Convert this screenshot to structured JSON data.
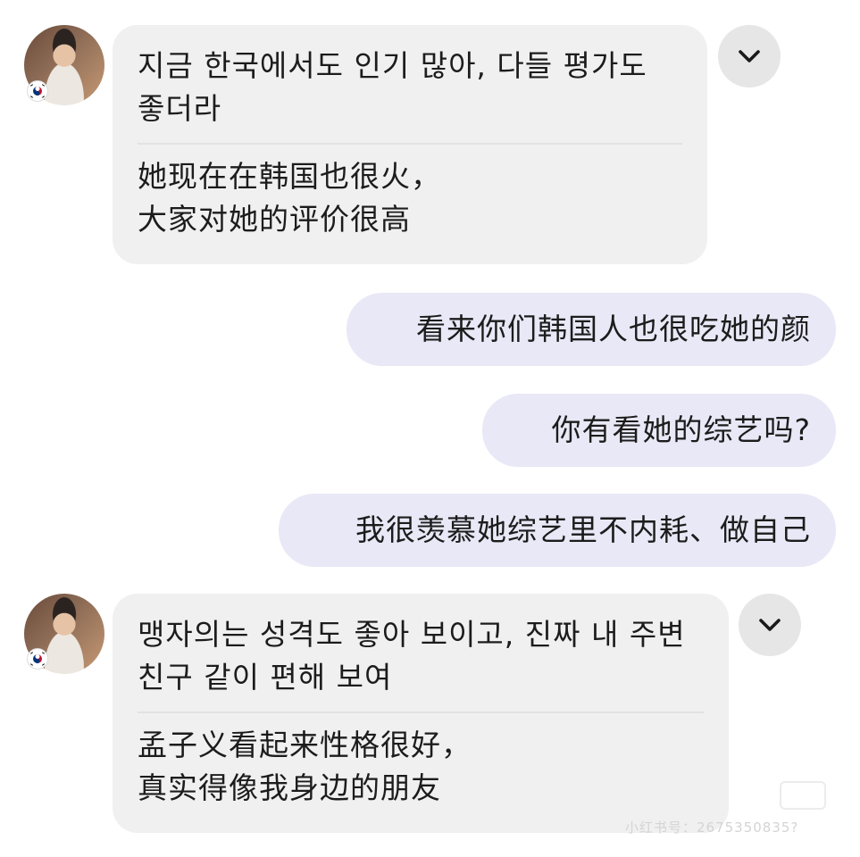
{
  "messages": [
    {
      "direction": "incoming",
      "original": "지금 한국에서도 인기 많아, 다들 평가도 좋더라",
      "translation": "她现在在韩国也很火，大家对她的评价很高"
    },
    {
      "direction": "outgoing",
      "text": "看来你们韩国人也很吃她的颜"
    },
    {
      "direction": "outgoing",
      "text": "你有看她的综艺吗?"
    },
    {
      "direction": "outgoing",
      "text": "我很羡慕她综艺里不内耗、做自己"
    },
    {
      "direction": "incoming",
      "original": "맹자의는 성격도 좋아 보이고, 진짜 내 주변 친구 같이 편해 보여",
      "translation": "孟子义看起来性格很好，真实得像我身边的朋友"
    }
  ],
  "icons": {
    "avatar": "avatar-photo",
    "flag": "south-korea-flag-icon",
    "expand": "chevron-down-icon"
  },
  "watermark": "小红书号：2675350835?",
  "colors": {
    "incoming_bubble": "#f0f0f0",
    "outgoing_bubble": "#e9e8f6",
    "chevron_button": "#e6e6e6",
    "text": "#1c1c1c"
  }
}
